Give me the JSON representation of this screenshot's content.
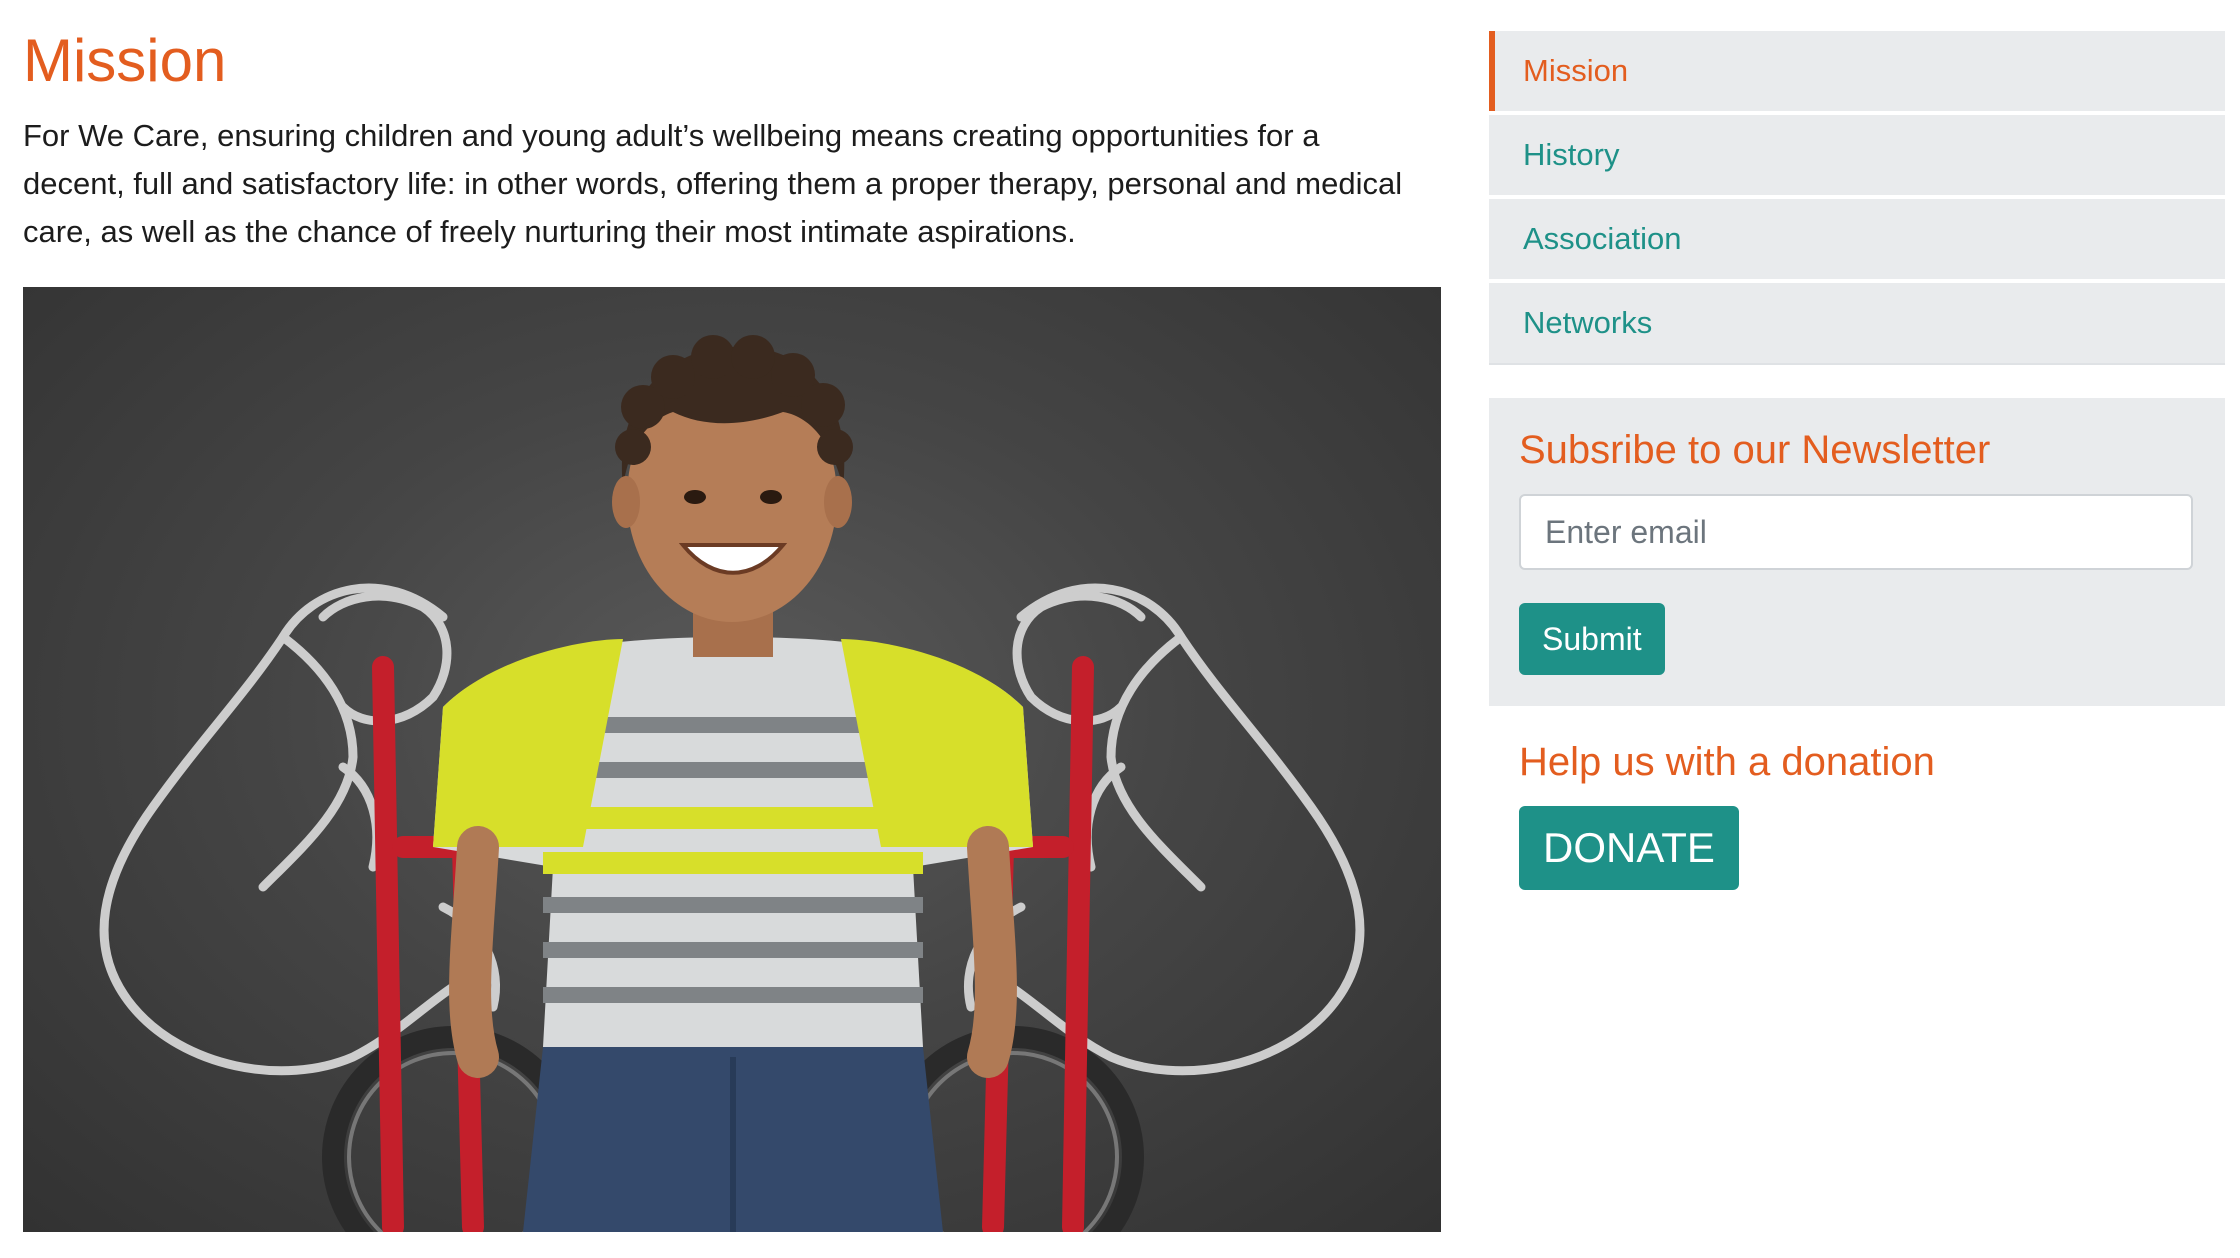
{
  "main": {
    "title": "Mission",
    "intro": "For We Care, ensuring children and young adult’s wellbeing means creating opportunities for a decent, full and satisfactory life: in other words, offering them a proper therapy, personal and medical care, as well as the chance of freely nurturing their most intimate aspirations."
  },
  "sidebar": {
    "nav": [
      {
        "label": "Mission",
        "active": true
      },
      {
        "label": "History",
        "active": false
      },
      {
        "label": "Association",
        "active": false
      },
      {
        "label": "Networks",
        "active": false
      }
    ],
    "newsletter": {
      "title": "Subsribe to our Newsletter",
      "email_placeholder": "Enter email",
      "submit_label": "Submit"
    },
    "donation": {
      "title": "Help us with a donation",
      "donate_label": "DONATE"
    }
  },
  "colors": {
    "accent_orange": "#e35d1f",
    "accent_teal": "#1e9188",
    "panel_gray": "#e9ebed"
  }
}
